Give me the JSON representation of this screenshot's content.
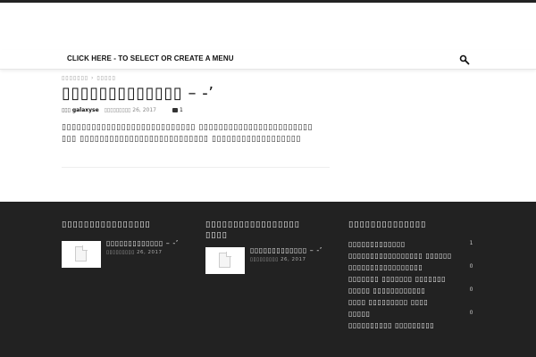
{
  "menu": {
    "link_label": "CLICK HERE - TO SELECT OR CREATE A MENU",
    "search_icon": "search-icon"
  },
  "post": {
    "breadcrumb": "▯▯▯▯▯▯▯ › ▯▯▯▯▯",
    "title": "▯▯▯▯▯▯▯▯▯▯▯▯▯ – -’",
    "author_prefix": "▯▯▯",
    "author": "galaxyse",
    "date": "▯▯▯▯▯▯▯▯▯ 26, 2017",
    "comments": "1",
    "excerpt": "▯▯▯▯▯▯▯▯▯▯▯▯▯▯▯▯▯▯▯▯▯▯▯▯▯▯▯ ▯▯▯▯▯▯▯▯▯▯▯▯▯▯▯▯▯▯▯▯▯▯▯ ▯▯▯ ▯▯▯▯▯▯▯▯▯▯▯▯▯▯▯▯▯▯▯▯▯▯▯▯▯▯ ▯▯▯▯▯▯▯▯▯▯▯▯▯▯▯▯▯▯"
  },
  "footer": {
    "col1": {
      "title": "▯▯▯▯▯▯▯▯▯▯▯▯▯▯▯▯",
      "post_title": "▯▯▯▯▯▯▯▯▯▯▯▯▯ – -’",
      "post_date": "▯▯▯▯▯▯▯▯▯ 26, 2017"
    },
    "col2": {
      "title": "▯▯▯▯▯▯▯▯▯▯▯▯▯▯▯▯▯ ▯▯▯▯",
      "post_title": "▯▯▯▯▯▯▯▯▯▯▯▯▯ – -’",
      "post_date": "▯▯▯▯▯▯▯▯▯ 26, 2017"
    },
    "col3": {
      "title": "▯▯▯▯▯▯▯▯▯▯▯▯▯▯",
      "categories": [
        {
          "name": "▯▯▯▯▯▯▯▯▯▯▯▯▯",
          "count": "1"
        },
        {
          "name": "▯▯▯▯▯▯▯▯▯▯▯▯▯▯▯▯▯ ▯▯▯▯▯▯",
          "count": ""
        },
        {
          "name": "▯▯▯▯▯▯▯▯▯▯▯▯▯▯▯▯▯",
          "count": "0"
        },
        {
          "name": "▯▯▯▯▯▯▯ ▯▯▯▯▯▯▯ ▯▯▯▯▯▯▯",
          "count": ""
        },
        {
          "name": "▯▯▯▯▯ ▯▯▯▯▯▯▯▯▯▯▯▯",
          "count": "0"
        },
        {
          "name": "▯▯▯▯ ▯▯▯▯▯▯▯▯▯ ▯▯▯▯",
          "count": ""
        },
        {
          "name": "▯▯▯▯▯",
          "count": "0"
        },
        {
          "name": "▯▯▯▯▯▯▯▯▯▯ ▯▯▯▯▯▯▯▯▯",
          "count": ""
        }
      ]
    }
  }
}
